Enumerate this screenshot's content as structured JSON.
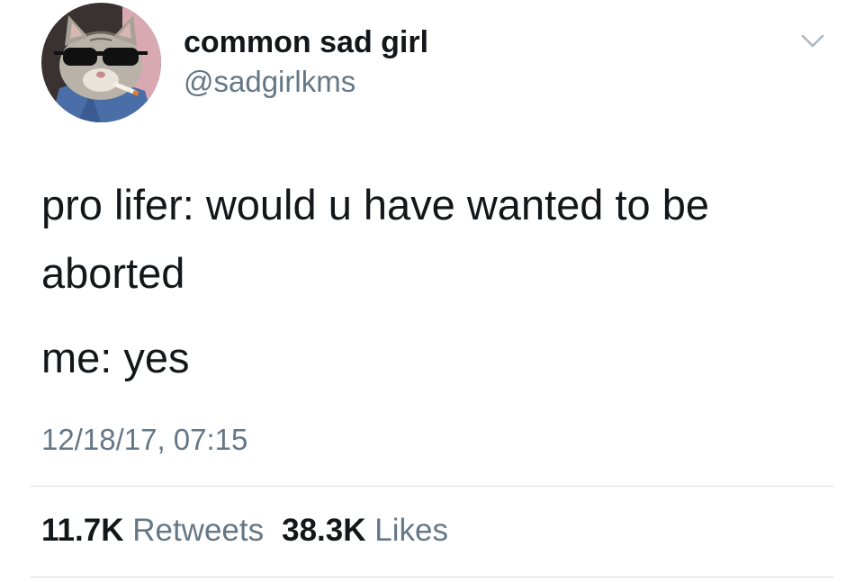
{
  "tweet": {
    "display_name": "common sad girl",
    "handle": "@sadgirlkms",
    "text_lines": [
      "pro lifer: would u have wanted to be aborted",
      "me: yes"
    ],
    "timestamp": "12/18/17, 07:15",
    "stats": {
      "retweets_count": "11.7K",
      "retweets_label": "Retweets",
      "likes_count": "38.3K",
      "likes_label": "Likes"
    }
  },
  "icons": {
    "menu": "chevron-down-icon",
    "avatar": "cat-with-sunglasses-avatar"
  },
  "colors": {
    "text_primary": "#14171a",
    "text_secondary": "#657786",
    "divider": "#dcdcdc",
    "background": "#ffffff"
  }
}
